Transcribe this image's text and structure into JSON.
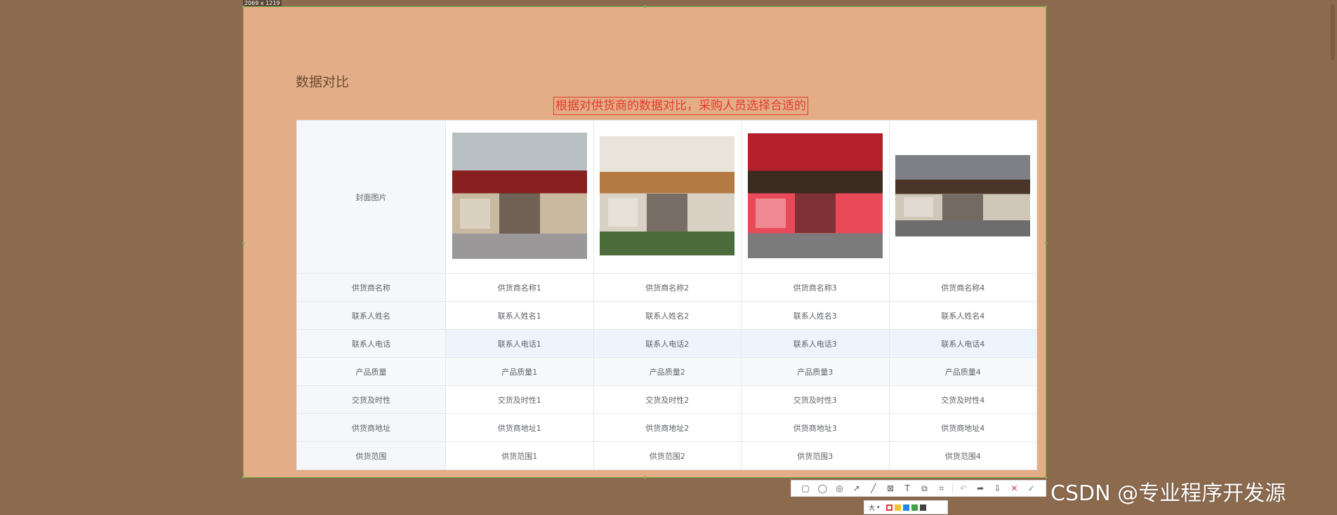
{
  "capture": {
    "size_label": "2069 x 1219"
  },
  "page": {
    "title": "数据对比",
    "hint": "根据对供货商的数据对比，采购人员选择合适的"
  },
  "table": {
    "image_row_label": "封面图片",
    "images": [
      {
        "name": "storefront-red-awning",
        "colors": [
          "#b8c0c4",
          "#8a1f1f",
          "#c8b9a0",
          "#9a9898"
        ]
      },
      {
        "name": "storefront-wood-door",
        "colors": [
          "#e8e4dc",
          "#b57a43",
          "#d9d1c4",
          "#4c6b3a"
        ]
      },
      {
        "name": "storefront-bestore",
        "colors": [
          "#b31f2a",
          "#3a2a20",
          "#e84a5a",
          "#7b7b7b"
        ]
      },
      {
        "name": "storefront-brown-sign",
        "colors": [
          "#7f8086",
          "#4a3628",
          "#cfc7b8",
          "#6d6d6d"
        ]
      }
    ],
    "rows": [
      {
        "label": "供货商名称",
        "cells": [
          "供货商名称1",
          "供货商名称2",
          "供货商名称3",
          "供货商名称4"
        ]
      },
      {
        "label": "联系人姓名",
        "cells": [
          "联系人姓名1",
          "联系人姓名2",
          "联系人姓名3",
          "联系人姓名4"
        ]
      },
      {
        "label": "联系人电话",
        "cells": [
          "联系人电话1",
          "联系人电话2",
          "联系人电话3",
          "联系人电话4"
        ]
      },
      {
        "label": "产品质量",
        "cells": [
          "产品质量1",
          "产品质量2",
          "产品质量3",
          "产品质量4"
        ]
      },
      {
        "label": "交货及时性",
        "cells": [
          "交货及时性1",
          "交货及时性2",
          "交货及时性3",
          "交货及时性4"
        ]
      },
      {
        "label": "供货商地址",
        "cells": [
          "供货商地址1",
          "供货商地址2",
          "供货商地址3",
          "供货商地址4"
        ]
      },
      {
        "label": "供货范围",
        "cells": [
          "供货范围1",
          "供货范围2",
          "供货范围3",
          "供货范围4"
        ]
      }
    ]
  },
  "toolbar": {
    "tools": [
      {
        "name": "rectangle-icon",
        "glyph": "▢"
      },
      {
        "name": "ellipse-icon",
        "glyph": "◯"
      },
      {
        "name": "mosaic-icon",
        "glyph": "◎"
      },
      {
        "name": "arrow-icon",
        "glyph": "↗"
      },
      {
        "name": "pen-icon",
        "glyph": "╱"
      },
      {
        "name": "blur-icon",
        "glyph": "⊠"
      },
      {
        "name": "text-icon",
        "glyph": "T"
      },
      {
        "name": "sticker-icon",
        "glyph": "⧉"
      },
      {
        "name": "ocr-icon",
        "glyph": "⌗"
      }
    ],
    "actions": [
      {
        "name": "undo-icon",
        "glyph": "↶"
      },
      {
        "name": "share-icon",
        "glyph": "➦"
      },
      {
        "name": "save-icon",
        "glyph": "⇩"
      },
      {
        "name": "close-icon",
        "glyph": "✕"
      },
      {
        "name": "confirm-icon",
        "glyph": "✓"
      }
    ]
  },
  "palette": {
    "size_label": "大",
    "colors": [
      "#e53935",
      "#fbc02d",
      "#1e88e5",
      "#43a047",
      "#424242"
    ]
  },
  "watermark": "CSDN @专业程序开发源"
}
